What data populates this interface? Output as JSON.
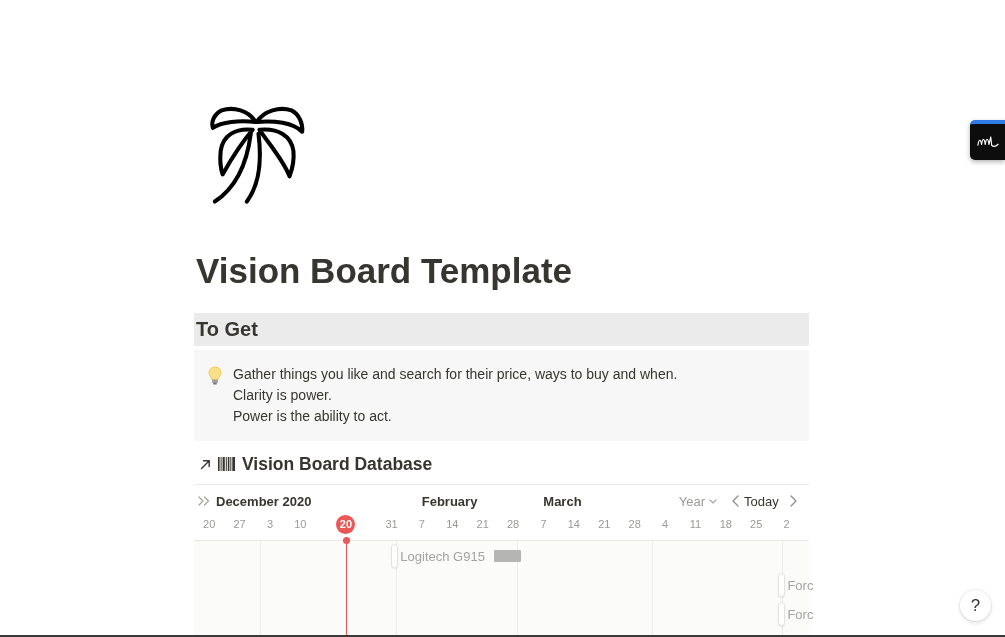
{
  "page": {
    "title": "Vision Board Template"
  },
  "heading": {
    "text": "To Get"
  },
  "callout": {
    "lines": [
      "Gather things you like and search for their price, ways to buy and when.",
      "Clarity is power.",
      "Power is the ability to act."
    ]
  },
  "database": {
    "title": "Vision Board Database",
    "timeline": {
      "months": [
        "December 2020",
        "February",
        "March"
      ],
      "view_menu": "Year",
      "today_button": "Today",
      "ticks": [
        {
          "label": "20",
          "today": false
        },
        {
          "label": "27",
          "today": false
        },
        {
          "label": "3",
          "today": false
        },
        {
          "label": "10",
          "today": false
        },
        {
          "label": "20",
          "today": true
        },
        {
          "label": "31",
          "today": false
        },
        {
          "label": "7",
          "today": false
        },
        {
          "label": "14",
          "today": false
        },
        {
          "label": "21",
          "today": false
        },
        {
          "label": "28",
          "today": false
        },
        {
          "label": "7",
          "today": false
        },
        {
          "label": "14",
          "today": false
        },
        {
          "label": "21",
          "today": false
        },
        {
          "label": "28",
          "today": false
        },
        {
          "label": "4",
          "today": false
        },
        {
          "label": "11",
          "today": false
        },
        {
          "label": "18",
          "today": false
        },
        {
          "label": "25",
          "today": false
        },
        {
          "label": "2",
          "today": false
        }
      ],
      "items": [
        {
          "label": "Logitech G915",
          "thumbnail": true
        },
        {
          "label": "Forc",
          "thumbnail": false
        },
        {
          "label": "Forc",
          "thumbnail": false
        }
      ]
    }
  },
  "help_button": {
    "label": "?"
  }
}
